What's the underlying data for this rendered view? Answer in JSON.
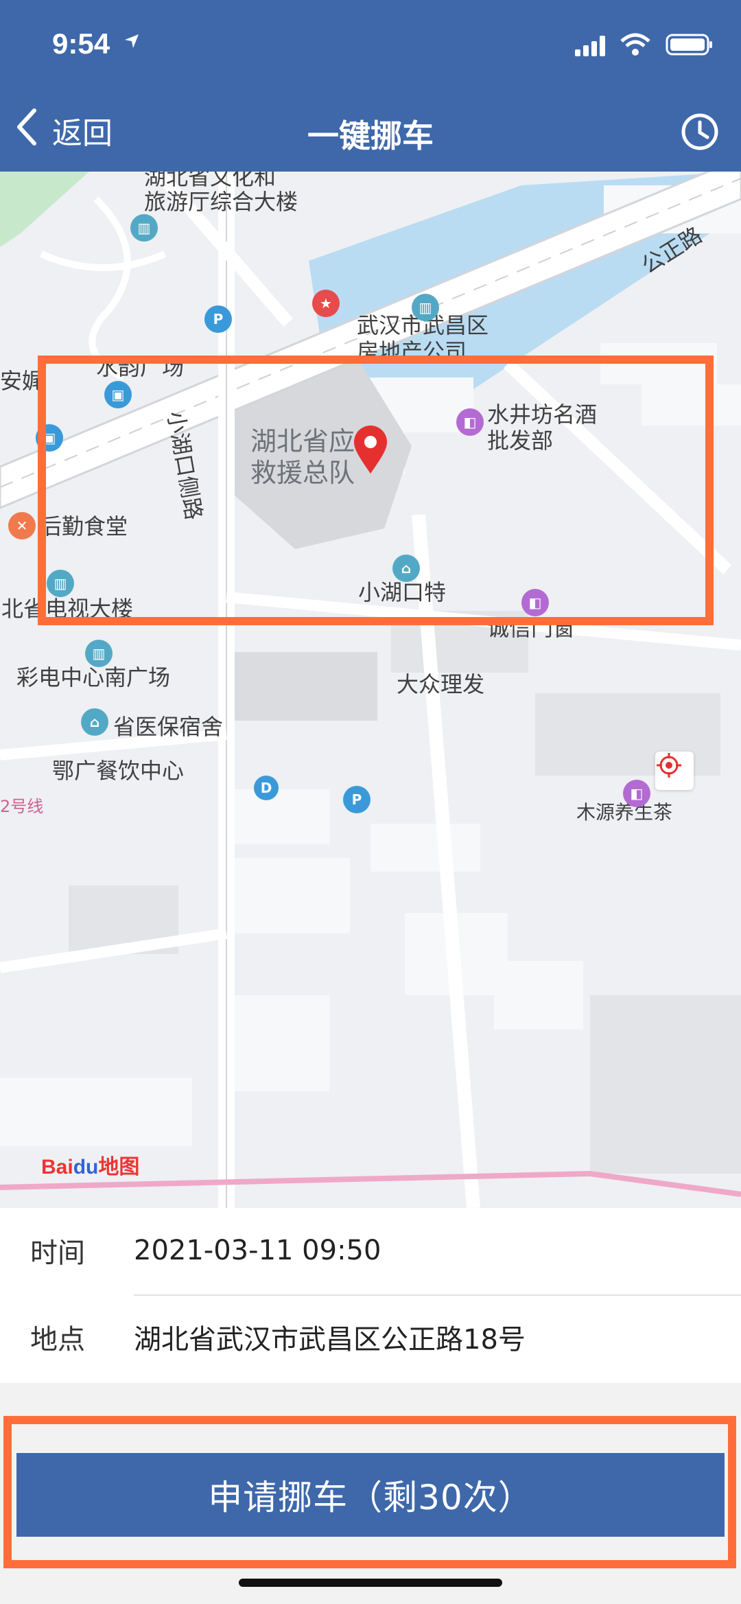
{
  "status_bar": {
    "time": "9:54"
  },
  "nav": {
    "back_label": "返回",
    "title": "一键挪车"
  },
  "map": {
    "labels": {
      "culture_building": "湖北省文化和\n旅游厅综合大楼",
      "shuiyun_square": "水韵广场",
      "wuchang_property": "武汉市武昌区\n房地产公司",
      "gongzheng_road": "公正路",
      "xiaohukou_side_road": "小湖口侧路",
      "rescue_team": "湖北省应急\n救援总队",
      "shuijingfang": "水井坊名酒\n批发部",
      "logistics_canteen": "后勤食堂",
      "xiaohukou_special": "小湖口特",
      "chengxin_window": "诚信门窗",
      "tv_building": "北省电视大楼",
      "caidian_square": "彩电中心南广场",
      "dazhong_barber": "大众理发",
      "hospital_dorm": "省医保宿舍",
      "food_center": "鄂广餐饮中心",
      "anni": "安娓",
      "line2": "2号线",
      "mu_yuan": "木源养生茶"
    },
    "logo": {
      "bai": "Bai",
      "du": "du",
      "ditu": "地图"
    }
  },
  "info": {
    "time_label": "时间",
    "time_value": "2021-03-11 09:50",
    "location_label": "地点",
    "location_value": "湖北省武汉市武昌区公正路18号"
  },
  "apply_button": {
    "label": "申请挪车（剩30次）"
  },
  "colors": {
    "primary": "#3e68aa",
    "highlight": "#ff6d3a",
    "marker": "#e53030"
  }
}
